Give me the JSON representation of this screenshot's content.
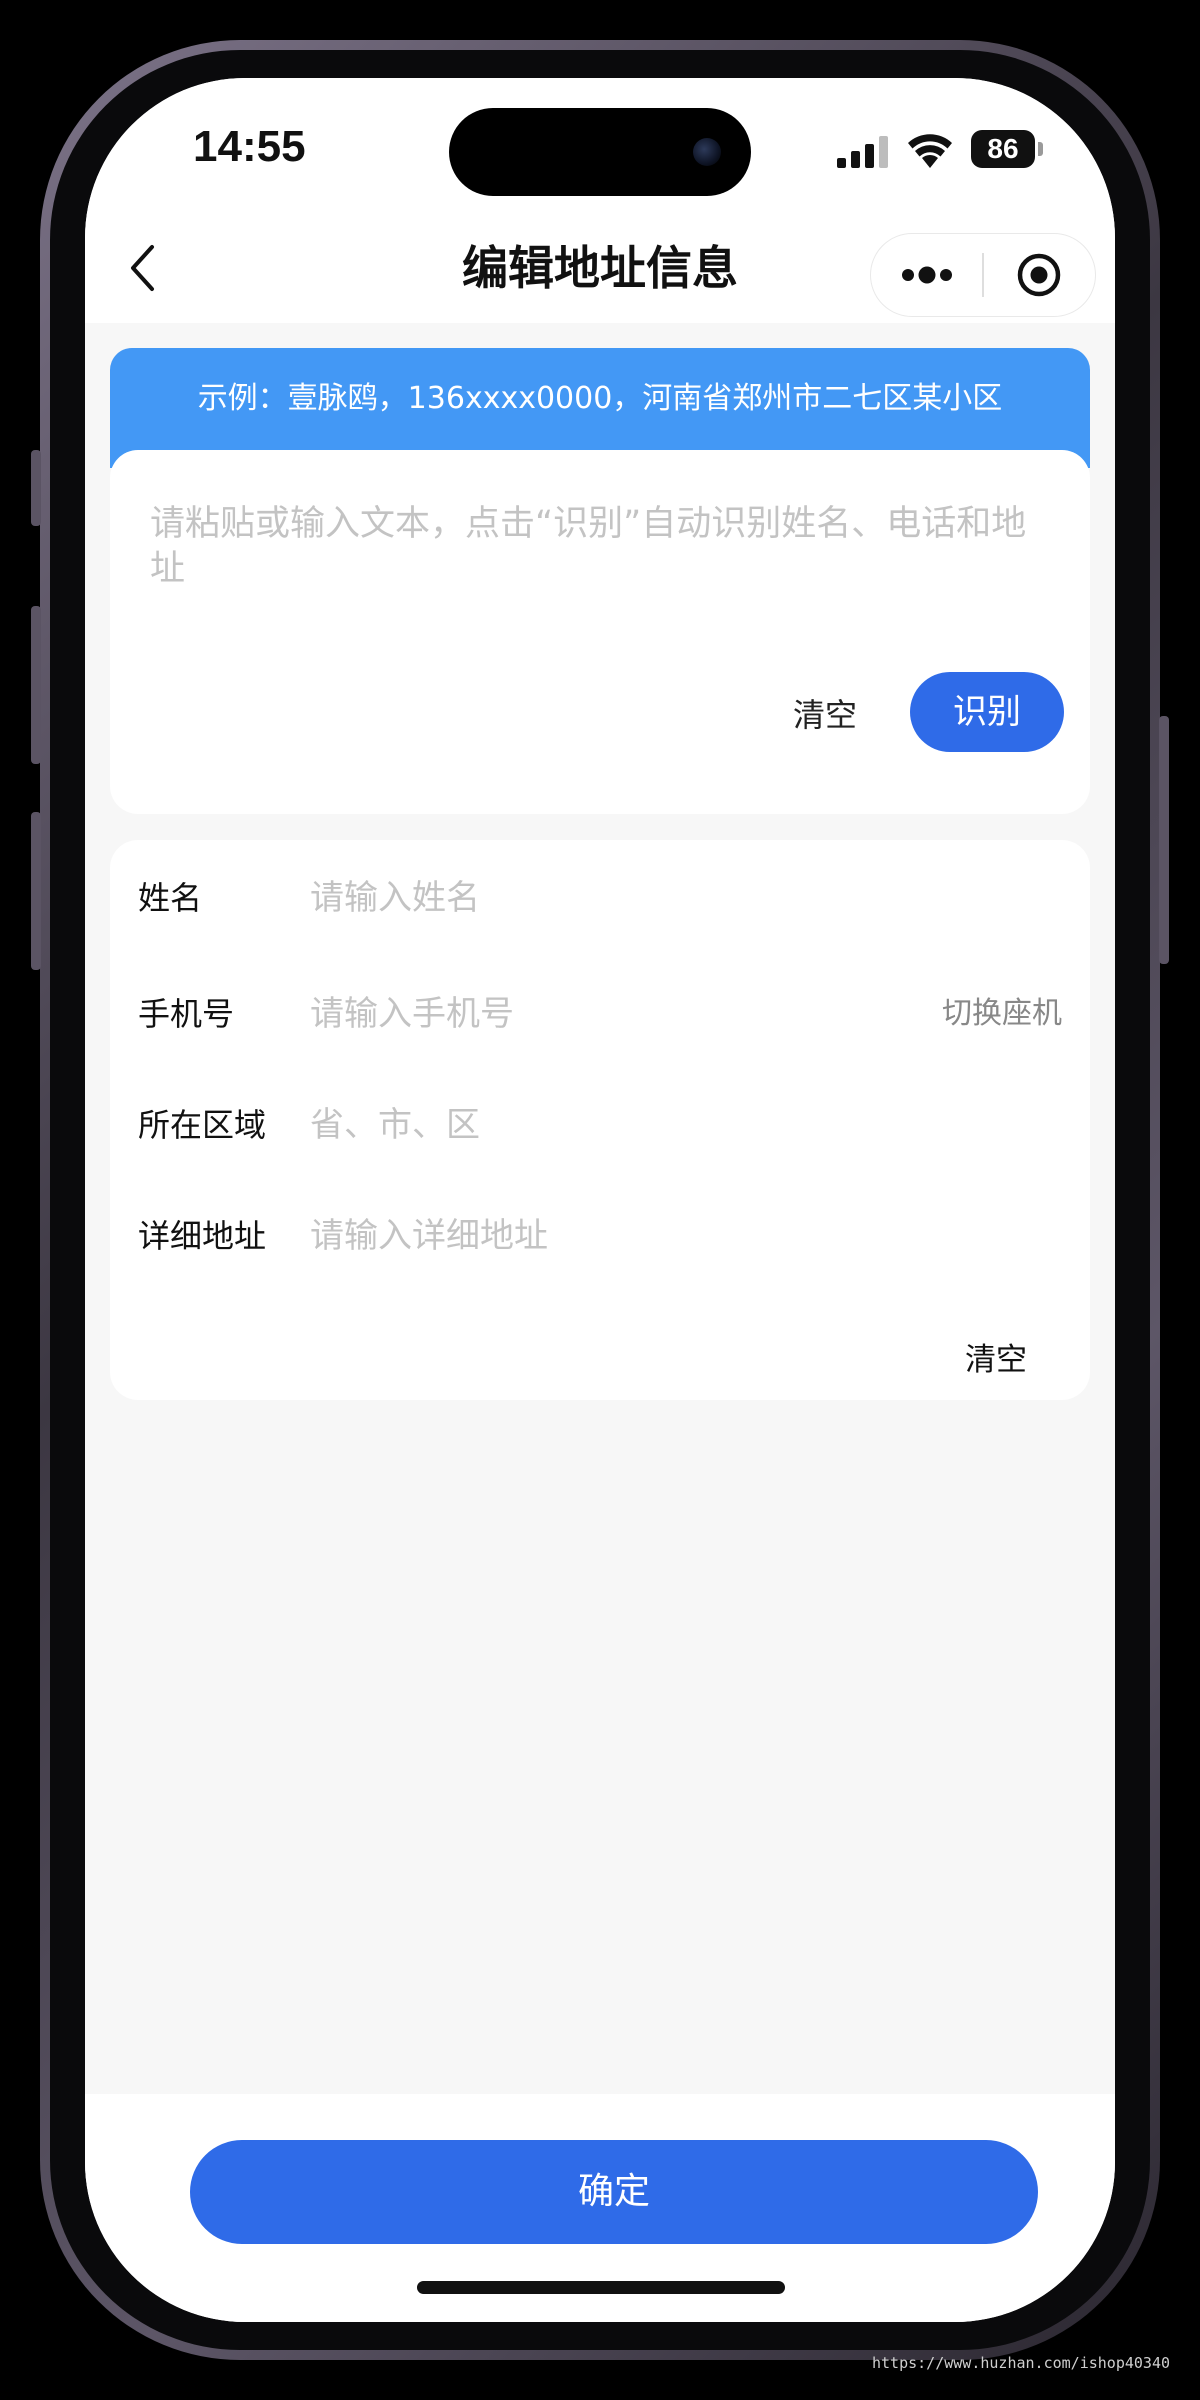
{
  "status_bar": {
    "time": "14:55",
    "battery": "86",
    "signal_icon": "cellular-signal-icon",
    "wifi_icon": "wifi-icon"
  },
  "nav": {
    "title": "编辑地址信息",
    "back_icon": "chevron-left-icon",
    "more_icon": "more-dots-icon",
    "close_icon": "target-circle-icon"
  },
  "paste_card": {
    "example": "示例：壹脉鸥，136xxxx0000，河南省郑州市二七区某小区",
    "placeholder": "请粘贴或输入文本，点击“识别”自动识别姓名、电话和地址",
    "clear_label": "清空",
    "recognize_label": "识别"
  },
  "form": {
    "name": {
      "label": "姓名",
      "placeholder": "请输入姓名"
    },
    "phone": {
      "label": "手机号",
      "placeholder": "请输入手机号",
      "switch_label": "切换座机"
    },
    "region": {
      "label": "所在区域",
      "placeholder": "省、市、区"
    },
    "detail": {
      "label": "详细地址",
      "placeholder": "请输入详细地址"
    },
    "clear_label": "清空"
  },
  "bottom": {
    "confirm_label": "确定"
  },
  "watermark": "https://www.huzhan.com/ishop40340",
  "colors": {
    "primary": "#2f6be8",
    "banner": "#4398f5",
    "background": "#f7f7f7",
    "placeholder": "#c3c3c3"
  }
}
